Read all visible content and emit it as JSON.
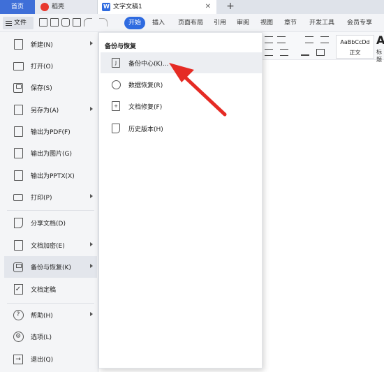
{
  "tabbar": {
    "home_tab": "首页",
    "daoke_tab": "稻壳",
    "doc_tab": "文字文稿1",
    "close_glyph": "✕",
    "new_tab_glyph": "+"
  },
  "menubar": {
    "file_label": "文件",
    "tabs": [
      "开始",
      "插入",
      "页面布局",
      "引用",
      "审阅",
      "视图",
      "章节",
      "开发工具",
      "会员专享"
    ],
    "active_tab": "开始"
  },
  "toolbar": {
    "style_sample": "AaBbCcDd",
    "style_normal": "正文",
    "style_heading_sample": "Aa",
    "style_heading": "标题"
  },
  "file_menu": {
    "items": [
      {
        "label": "新建(N)",
        "icon": "new-doc-icon",
        "arrow": true
      },
      {
        "label": "打开(O)",
        "icon": "open-folder-icon",
        "arrow": false
      },
      {
        "label": "保存(S)",
        "icon": "save-icon",
        "arrow": false
      },
      {
        "label": "另存为(A)",
        "icon": "save-as-icon",
        "arrow": true
      },
      {
        "label": "输出为PDF(F)",
        "icon": "pdf-icon",
        "arrow": false
      },
      {
        "label": "输出为图片(G)",
        "icon": "image-icon",
        "arrow": false
      },
      {
        "label": "输出为PPTX(X)",
        "icon": "pptx-icon",
        "arrow": false
      },
      {
        "label": "打印(P)",
        "icon": "printer-icon",
        "arrow": true
      },
      {
        "label": "分享文档(D)",
        "icon": "share-icon",
        "arrow": false
      },
      {
        "label": "文档加密(E)",
        "icon": "lock-doc-icon",
        "arrow": true
      },
      {
        "label": "备份与恢复(K)",
        "icon": "backup-icon",
        "arrow": true,
        "selected": true
      },
      {
        "label": "文档定稿",
        "icon": "finalize-icon",
        "arrow": false
      },
      {
        "label": "帮助(H)",
        "icon": "help-icon",
        "arrow": true
      },
      {
        "label": "选项(L)",
        "icon": "gear-icon",
        "arrow": false
      },
      {
        "label": "退出(Q)",
        "icon": "exit-icon",
        "arrow": false
      }
    ]
  },
  "submenu": {
    "title": "备份与恢复",
    "items": [
      {
        "label": "备份中心(K)...",
        "icon": "backup-center-icon",
        "highlight": true
      },
      {
        "label": "数据恢复(R)",
        "icon": "data-restore-icon"
      },
      {
        "label": "文档修复(F)",
        "icon": "doc-repair-icon"
      },
      {
        "label": "历史版本(H)",
        "icon": "history-version-icon"
      }
    ]
  },
  "colors": {
    "accent": "#2f6be0",
    "home_tab": "#3f6fd8",
    "annotation_arrow": "#e52b24"
  }
}
